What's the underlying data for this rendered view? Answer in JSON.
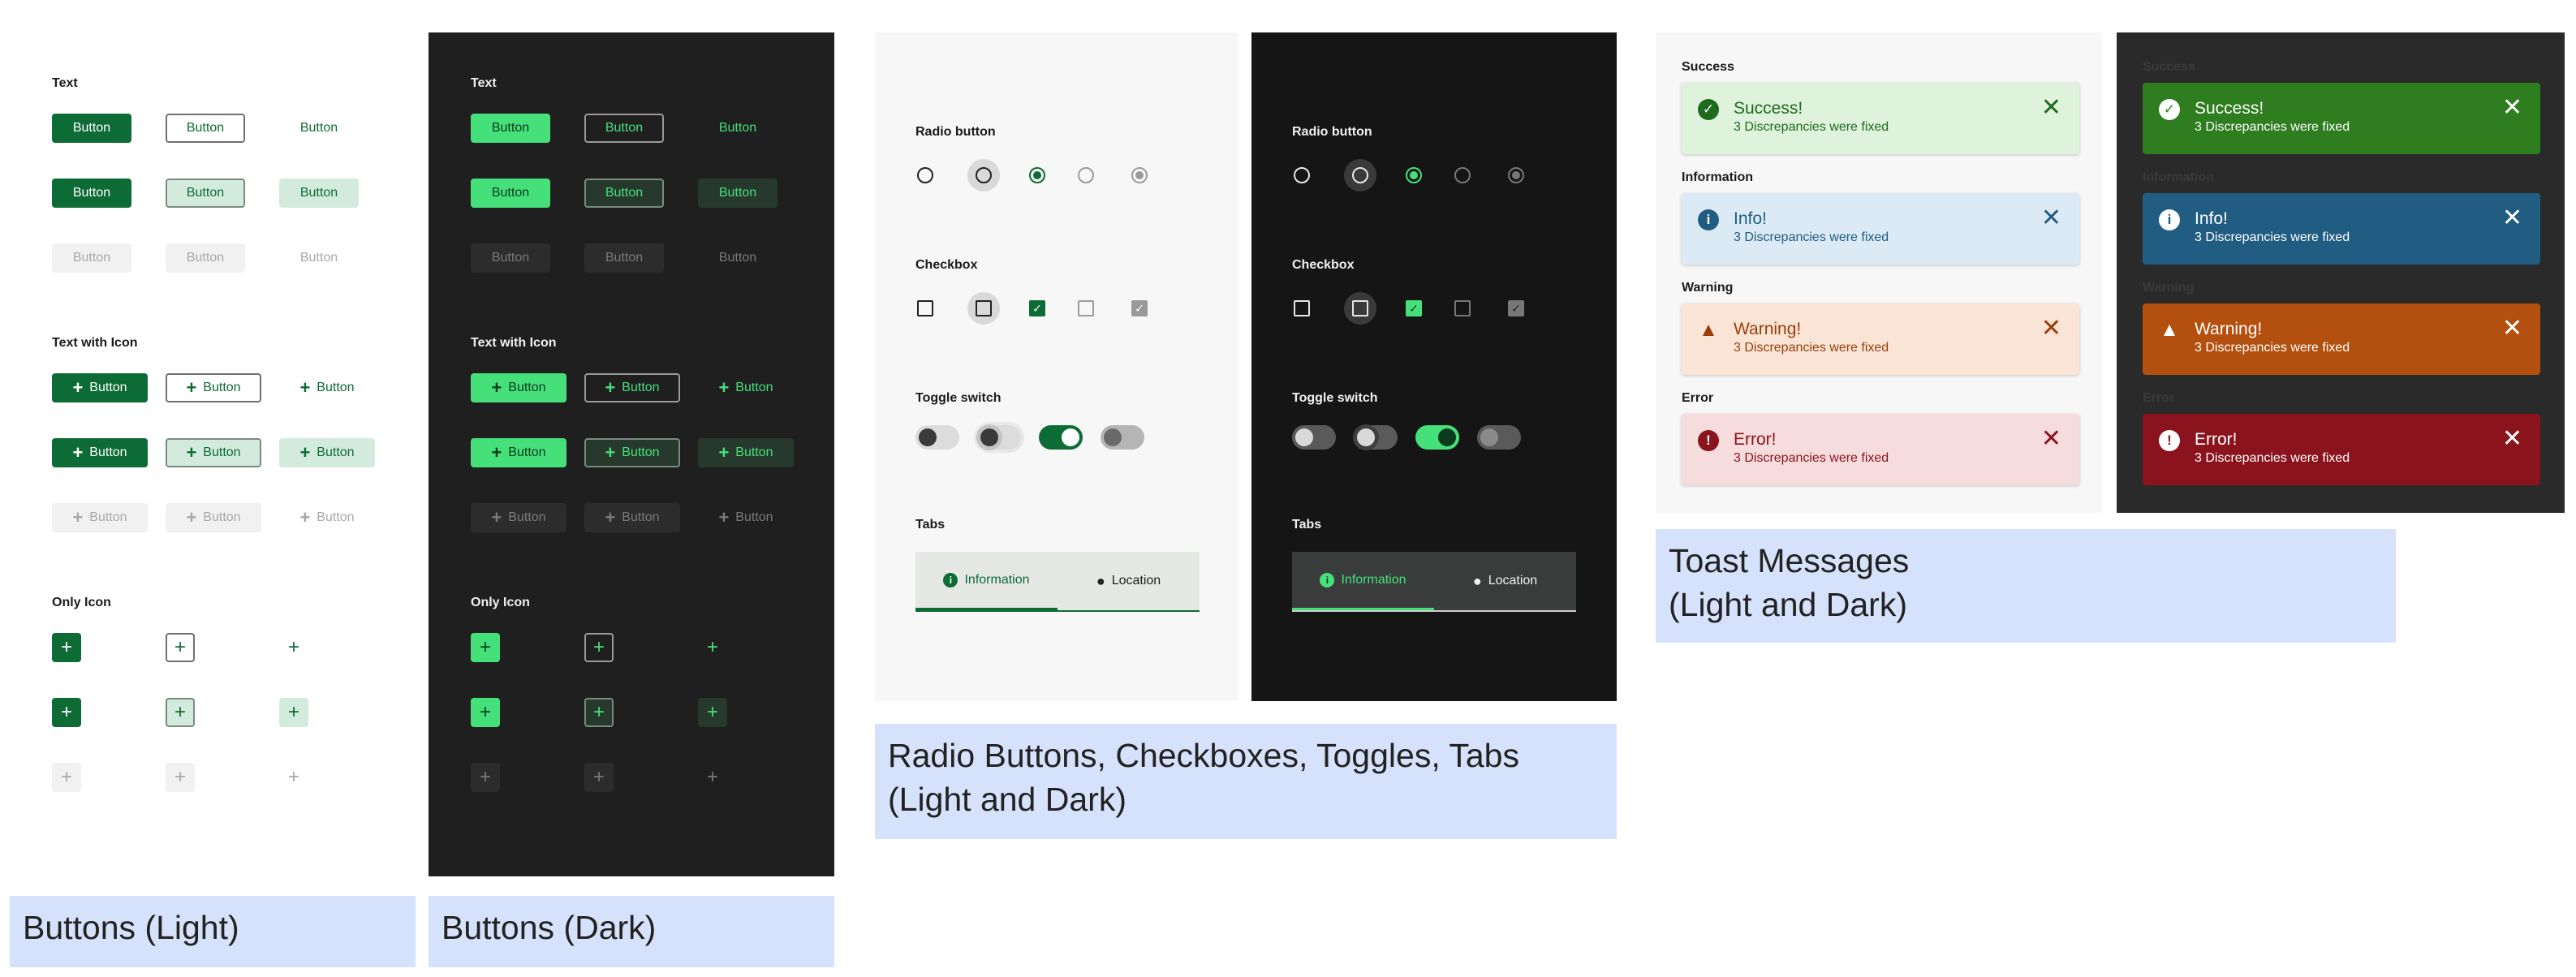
{
  "buttons": {
    "text_label": "Text",
    "text_with_icon_label": "Text with Icon",
    "only_icon_label": "Only Icon",
    "button_label": "Button",
    "plus_glyph": "+"
  },
  "controls": {
    "radio_label": "Radio button",
    "checkbox_label": "Checkbox",
    "toggle_label": "Toggle switch",
    "tabs_label": "Tabs",
    "tab_information": "Information",
    "tab_location": "Location"
  },
  "toasts": {
    "success_label": "Success",
    "information_label": "Information",
    "warning_label": "Warning",
    "error_label": "Error",
    "success_title": "Success!",
    "info_title": "Info!",
    "warning_title": "Warning!",
    "error_title": "Error!",
    "body": "3 Discrepancies were fixed",
    "close_glyph": "✕"
  },
  "captions": {
    "buttons_light": "Buttons (Light)",
    "buttons_dark": "Buttons (Dark)",
    "controls_line1": "Radio Buttons, Checkboxes, Toggles, Tabs",
    "controls_line2": "(Light and Dark)",
    "toasts_line1": "Toast Messages",
    "toasts_line2": "(Light and Dark)"
  },
  "colors": {
    "light_primary": "#0d6b35",
    "dark_primary": "#46e07b",
    "success_light": "#dff2dc",
    "info_light": "#dbeaf5",
    "warning_light": "#f9e4d6",
    "error_light": "#f6dcdc",
    "success_dark": "#2e7d1f",
    "info_dark": "#215d82",
    "warning_dark": "#b3500f",
    "error_dark": "#8a131d"
  }
}
